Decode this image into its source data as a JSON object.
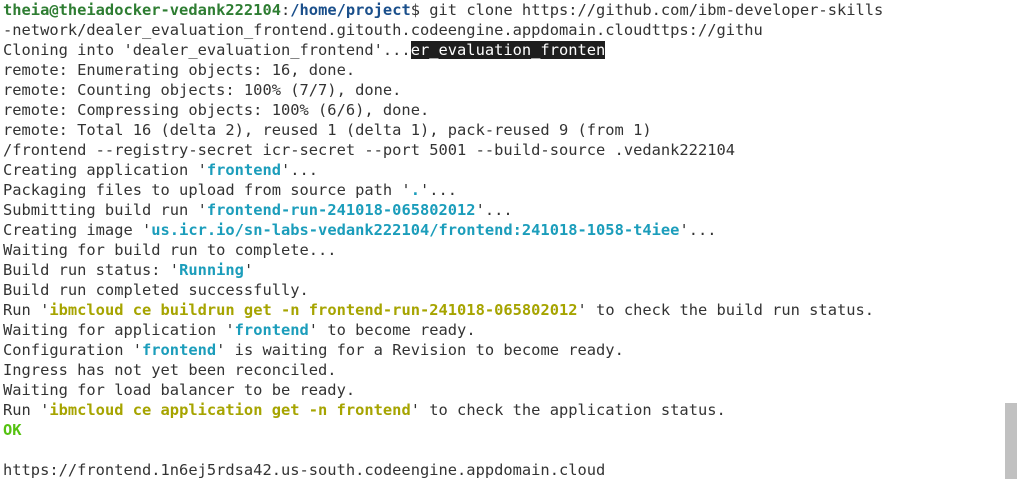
{
  "terminal": {
    "colors": {
      "prompt_user": "#2e7d32",
      "prompt_path": "#1a4f8b",
      "quoted_value": "#1b9dbb",
      "command_hint": "#a6a400",
      "ok": "#55c211",
      "selection_bg": "#1e1e1e"
    },
    "lines": [
      [
        {
          "text": "theia@theiadocker-vedank222104",
          "style": "green"
        },
        {
          "text": ":",
          "style": ""
        },
        {
          "text": "/home/project",
          "style": "blue"
        },
        {
          "text": "$ git clone https://github.com/ibm-developer-skills",
          "style": ""
        }
      ],
      [
        {
          "text": "-network/dealer_evaluation_frontend.gitouth.codeengine.appdomain.cloudttps://githu",
          "style": ""
        }
      ],
      [
        {
          "text": "Cloning into 'dealer_evaluation_frontend'...",
          "style": ""
        },
        {
          "text": "er_evaluation_fronten",
          "style": "sel"
        }
      ],
      [
        {
          "text": "remote: Enumerating objects: 16, done.",
          "style": ""
        }
      ],
      [
        {
          "text": "remote: Counting objects: 100% (7/7), done.",
          "style": ""
        }
      ],
      [
        {
          "text": "remote: Compressing objects: 100% (6/6), done.",
          "style": ""
        }
      ],
      [
        {
          "text": "remote: Total 16 (delta 2), reused 1 (delta 1), pack-reused 9 (from 1)",
          "style": ""
        }
      ],
      [
        {
          "text": "/frontend --registry-secret icr-secret --port 5001 --build-source .vedank222104",
          "style": ""
        }
      ],
      [
        {
          "text": "Creating application '",
          "style": ""
        },
        {
          "text": "frontend",
          "style": "cyan"
        },
        {
          "text": "'...",
          "style": ""
        }
      ],
      [
        {
          "text": "Packaging files to upload from source path '",
          "style": ""
        },
        {
          "text": ".",
          "style": "cyan"
        },
        {
          "text": "'...",
          "style": ""
        }
      ],
      [
        {
          "text": "Submitting build run '",
          "style": ""
        },
        {
          "text": "frontend-run-241018-065802012",
          "style": "cyan"
        },
        {
          "text": "'...",
          "style": ""
        }
      ],
      [
        {
          "text": "Creating image '",
          "style": ""
        },
        {
          "text": "us.icr.io/sn-labs-vedank222104/frontend:241018-1058-t4iee",
          "style": "cyan"
        },
        {
          "text": "'...",
          "style": ""
        }
      ],
      [
        {
          "text": "Waiting for build run to complete...",
          "style": ""
        }
      ],
      [
        {
          "text": "Build run status: '",
          "style": ""
        },
        {
          "text": "Running",
          "style": "cyan"
        },
        {
          "text": "'",
          "style": ""
        }
      ],
      [
        {
          "text": "Build run completed successfully.",
          "style": ""
        }
      ],
      [
        {
          "text": "Run '",
          "style": ""
        },
        {
          "text": "ibmcloud ce buildrun get -n frontend-run-241018-065802012",
          "style": "yellow"
        },
        {
          "text": "' to check the build run status.",
          "style": ""
        }
      ],
      [
        {
          "text": "Waiting for application '",
          "style": ""
        },
        {
          "text": "frontend",
          "style": "cyan"
        },
        {
          "text": "' to become ready.",
          "style": ""
        }
      ],
      [
        {
          "text": "Configuration '",
          "style": ""
        },
        {
          "text": "frontend",
          "style": "cyan"
        },
        {
          "text": "' is waiting for a Revision to become ready.",
          "style": ""
        }
      ],
      [
        {
          "text": "Ingress has not yet been reconciled.",
          "style": ""
        }
      ],
      [
        {
          "text": "Waiting for load balancer to be ready.",
          "style": ""
        }
      ],
      [
        {
          "text": "Run '",
          "style": ""
        },
        {
          "text": "ibmcloud ce application get -n frontend",
          "style": "yellow"
        },
        {
          "text": "' to check the application status.",
          "style": ""
        }
      ],
      [
        {
          "text": "OK",
          "style": "lime"
        }
      ],
      [
        {
          "text": "",
          "style": ""
        }
      ],
      [
        {
          "text": "https://frontend.1n6ej5rdsa42.us-south.codeengine.appdomain.cloud",
          "style": ""
        }
      ]
    ]
  }
}
